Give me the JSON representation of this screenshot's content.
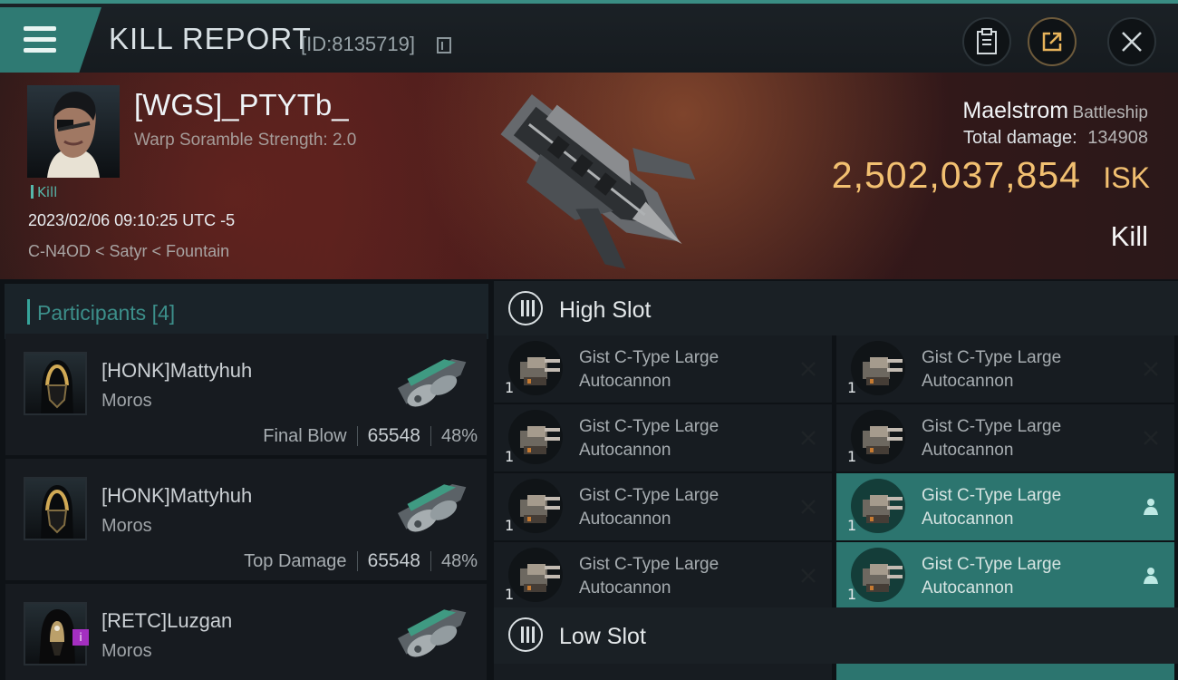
{
  "header": {
    "title": "KILL REPORT",
    "report_id": "[ID:8135719]"
  },
  "victim": {
    "name": "[WGS]_PTYTb_",
    "status": "Warp Soramble Strength: 2.0",
    "kill_label": "Kill",
    "datetime": "2023/02/06 09:10:25 UTC -5",
    "location": "C-N4OD < Satyr < Fountain"
  },
  "ship": {
    "name": "Maelstrom",
    "class": "Battleship",
    "damage_label": "Total damage:",
    "total_damage": 134908,
    "isk_value": "2,502,037,854",
    "isk_unit": "ISK",
    "kill_type": "Kill"
  },
  "participants": {
    "title": "Participants",
    "count_label": "[4]",
    "items": [
      {
        "name": "[HONK]Mattyhuh",
        "ship": "Moros",
        "tag": "Final Blow",
        "damage": 65548,
        "percent": "48%"
      },
      {
        "name": "[HONK]Mattyhuh",
        "ship": "Moros",
        "tag": "Top Damage",
        "damage": 65548,
        "percent": "48%"
      },
      {
        "name": "[RETC]Luzgan",
        "ship": "Moros",
        "badge": "i"
      }
    ]
  },
  "slots": {
    "high": {
      "title": "High Slot",
      "modules": [
        {
          "name": "Gist C-Type Large Autocannon",
          "quantity": "1",
          "status": "destroyed",
          "active": false
        },
        {
          "name": "Gist C-Type Large Autocannon",
          "quantity": "1",
          "status": "destroyed",
          "active": false
        },
        {
          "name": "Gist C-Type Large Autocannon",
          "quantity": "1",
          "status": "destroyed",
          "active": false
        },
        {
          "name": "Gist C-Type Large Autocannon",
          "quantity": "1",
          "status": "destroyed",
          "active": false
        },
        {
          "name": "Gist C-Type Large Autocannon",
          "quantity": "1",
          "status": "destroyed",
          "active": false
        },
        {
          "name": "Gist C-Type Large Autocannon",
          "quantity": "1",
          "status": "dropped",
          "active": true
        },
        {
          "name": "Gist C-Type Large Autocannon",
          "quantity": "1",
          "status": "destroyed",
          "active": false
        },
        {
          "name": "Gist C-Type Large Autocannon",
          "quantity": "1",
          "status": "dropped",
          "active": true
        }
      ]
    },
    "low": {
      "title": "Low Slot"
    }
  },
  "colors": {
    "accent": "#2c756f",
    "isk": "#f2c071",
    "kill_text": "#56b8ab"
  }
}
